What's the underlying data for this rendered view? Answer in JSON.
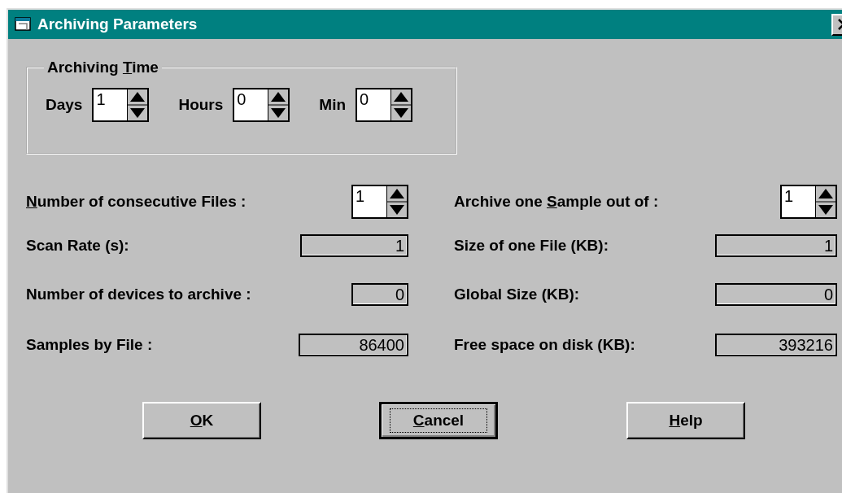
{
  "window": {
    "title": "Archiving Parameters"
  },
  "archiving_time": {
    "title": [
      {
        "text": "Archiving ",
        "underline": false
      },
      {
        "text": "T",
        "underline": true
      },
      {
        "text": "ime",
        "underline": false
      }
    ],
    "spinners": [
      {
        "label": "Days",
        "value": "1"
      },
      {
        "label": "Hours",
        "value": "0"
      },
      {
        "label": "Min",
        "value": "0"
      }
    ]
  },
  "left_fields": [
    {
      "kind": "spinner",
      "label": [
        {
          "text": "N",
          "underline": true
        },
        {
          "text": "umber of consecutive Files :",
          "underline": false
        }
      ],
      "value": "1"
    },
    {
      "kind": "readout",
      "label": [
        {
          "text": "Scan Rate (s):",
          "underline": false
        }
      ],
      "value": "1"
    },
    {
      "kind": "readout",
      "label": [
        {
          "text": "Number of devices to archive :",
          "underline": false
        }
      ],
      "value": "0"
    },
    {
      "kind": "readout",
      "label": [
        {
          "text": "Samples by File :",
          "underline": false
        }
      ],
      "value": "86400"
    }
  ],
  "right_fields": [
    {
      "kind": "spinner",
      "label": [
        {
          "text": "Archive one ",
          "underline": false
        },
        {
          "text": "S",
          "underline": true
        },
        {
          "text": "ample out of :",
          "underline": false
        }
      ],
      "value": "1"
    },
    {
      "kind": "readout",
      "label": [
        {
          "text": "Size of one File (KB):",
          "underline": false
        }
      ],
      "value": "1"
    },
    {
      "kind": "readout",
      "label": [
        {
          "text": "Global Size (KB):",
          "underline": false
        }
      ],
      "value": "0"
    },
    {
      "kind": "readout",
      "label": [
        {
          "text": "Free space on disk (KB):",
          "underline": false
        }
      ],
      "value": "393216"
    }
  ],
  "buttons": [
    {
      "label": [
        {
          "text": "O",
          "underline": true
        },
        {
          "text": "K",
          "underline": false
        }
      ],
      "focused": false
    },
    {
      "label": [
        {
          "text": "C",
          "underline": true
        },
        {
          "text": "ancel",
          "underline": false
        }
      ],
      "focused": true
    },
    {
      "label": [
        {
          "text": "H",
          "underline": true
        },
        {
          "text": "elp",
          "underline": false
        }
      ],
      "focused": false
    }
  ]
}
